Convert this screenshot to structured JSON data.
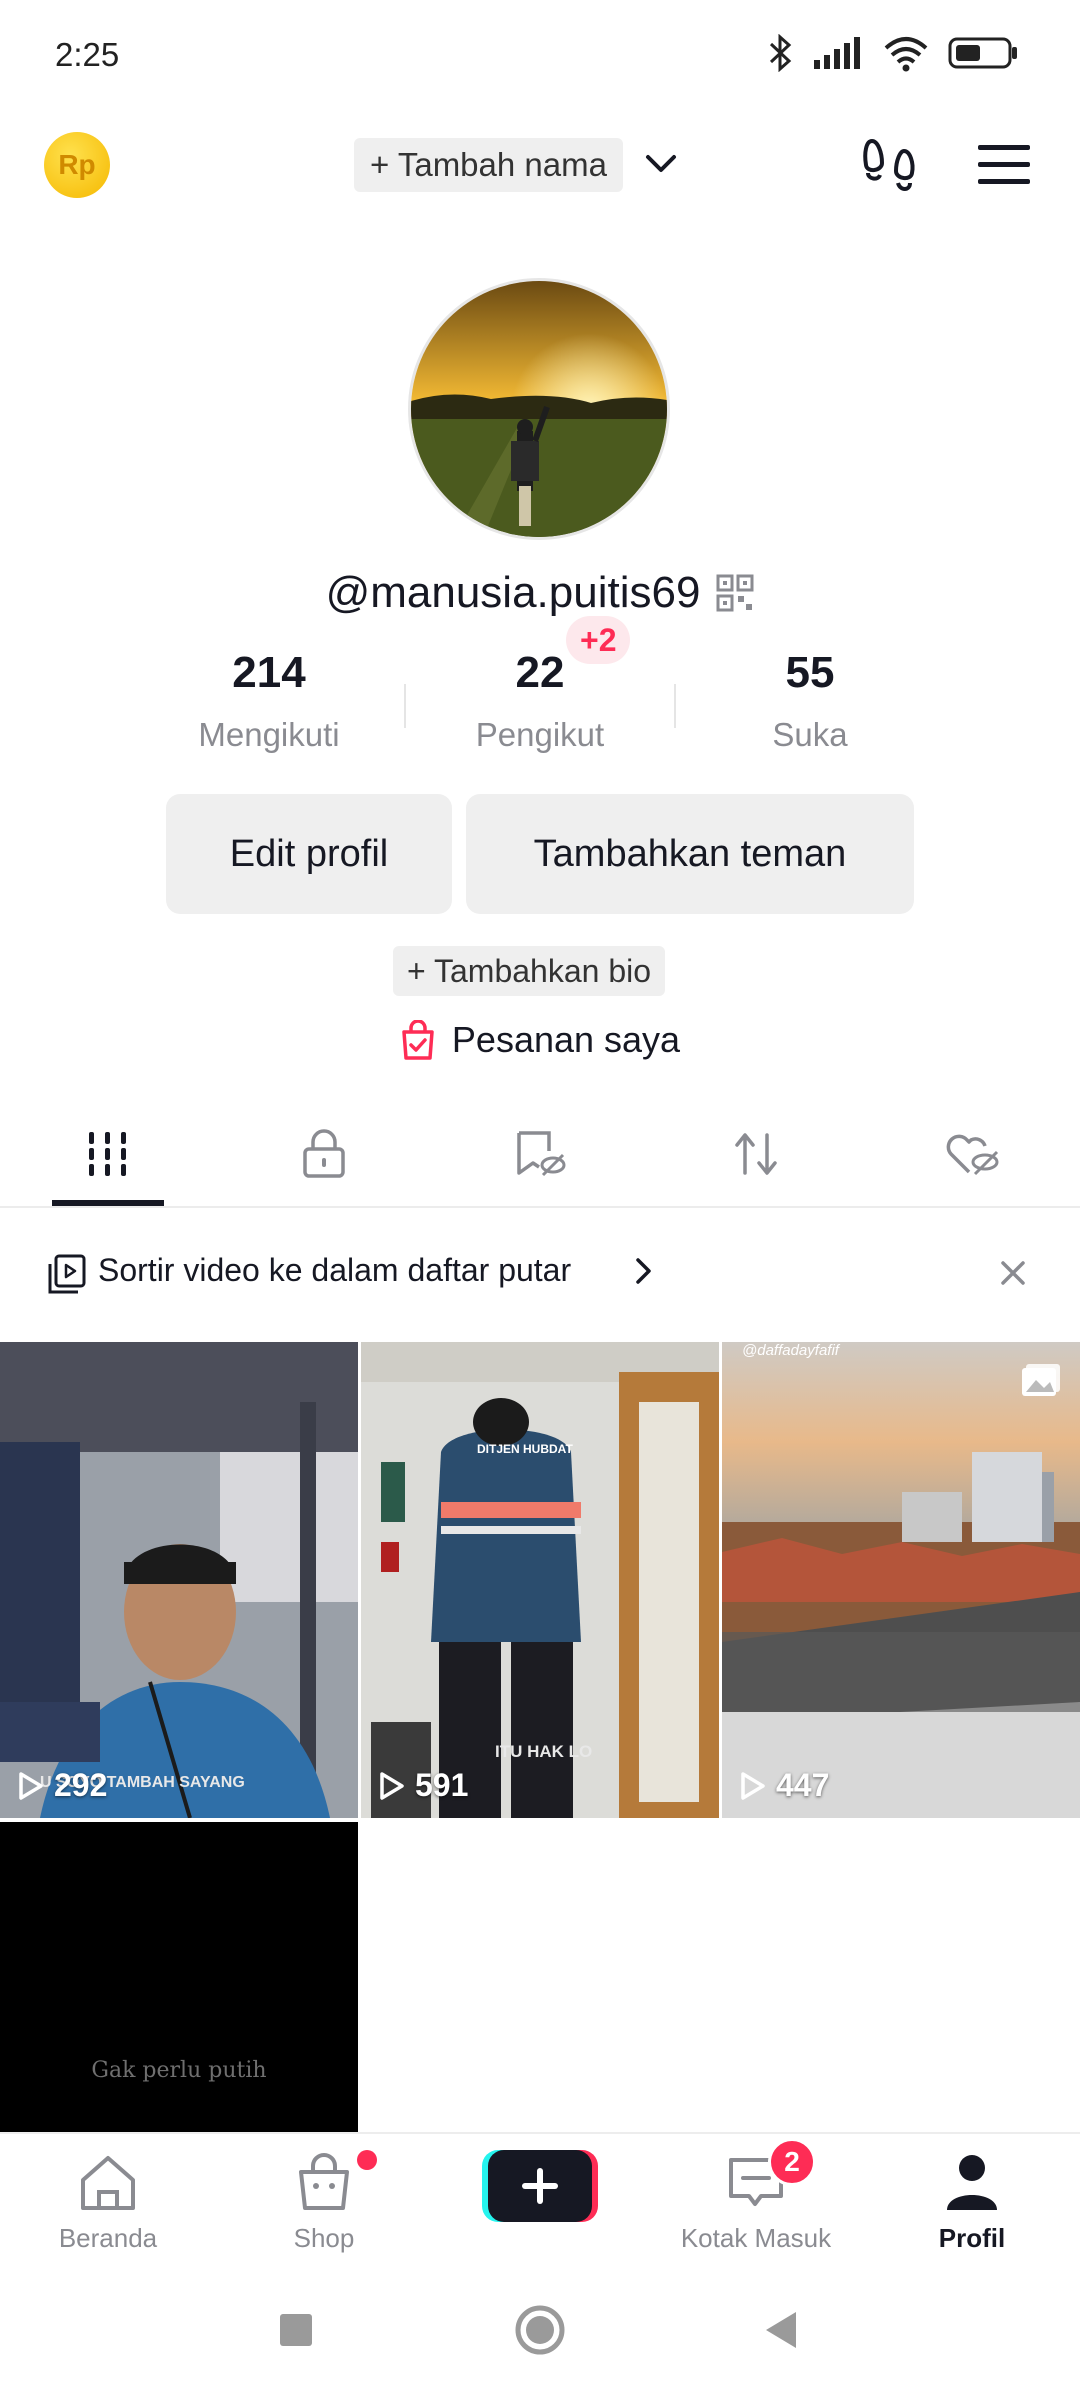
{
  "status_bar": {
    "time": "2:25"
  },
  "top_bar": {
    "coin_label": "Rp",
    "add_name_label": "+ Tambah nama"
  },
  "profile": {
    "username": "@manusia.puitis69",
    "stats": [
      {
        "value": "214",
        "label": "Mengikuti"
      },
      {
        "value": "22",
        "label": "Pengikut",
        "badge": "+2"
      },
      {
        "value": "55",
        "label": "Suka"
      }
    ],
    "edit_profile_label": "Edit profil",
    "add_friends_label": "Tambahkan teman",
    "add_bio_label": "+ Tambahkan bio",
    "orders_label": "Pesanan saya"
  },
  "tabs": [
    {
      "icon": "videos-grid-icon",
      "active": true
    },
    {
      "icon": "lock-icon",
      "active": false
    },
    {
      "icon": "hidden-bookmark-icon",
      "active": false
    },
    {
      "icon": "repost-icon",
      "active": false
    },
    {
      "icon": "hidden-heart-icon",
      "active": false
    }
  ],
  "playlist_banner": {
    "text": "Sortir video ke dalam daftar putar"
  },
  "videos": [
    {
      "views": "292",
      "caption": "U SOYO TAMBAH SAYANG"
    },
    {
      "views": "591",
      "caption": "ITU HAK LO",
      "badge_text": "DITJEN HUBDAT"
    },
    {
      "views": "447",
      "caption": "@daffadayfafif"
    },
    {
      "caption": "Gak perlu putih"
    }
  ],
  "bottom_nav": {
    "home": "Beranda",
    "shop": "Shop",
    "inbox": "Kotak Masuk",
    "inbox_badge": "2",
    "profile": "Profil"
  }
}
